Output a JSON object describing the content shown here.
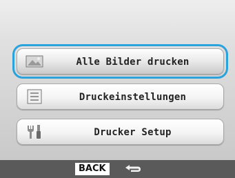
{
  "menu": {
    "items": [
      {
        "label": "Alle Bilder drucken",
        "icon": "image-icon",
        "selected": true
      },
      {
        "label": "Druckeinstellungen",
        "icon": "settings-list-icon",
        "selected": false
      },
      {
        "label": "Drucker Setup",
        "icon": "tools-icon",
        "selected": false
      }
    ]
  },
  "bottom_bar": {
    "back_label": "BACK",
    "back_icon": "return-arrow-icon"
  },
  "colors": {
    "selection_outline": "#2aa3dd",
    "bottom_bar": "#5a5a5a"
  }
}
